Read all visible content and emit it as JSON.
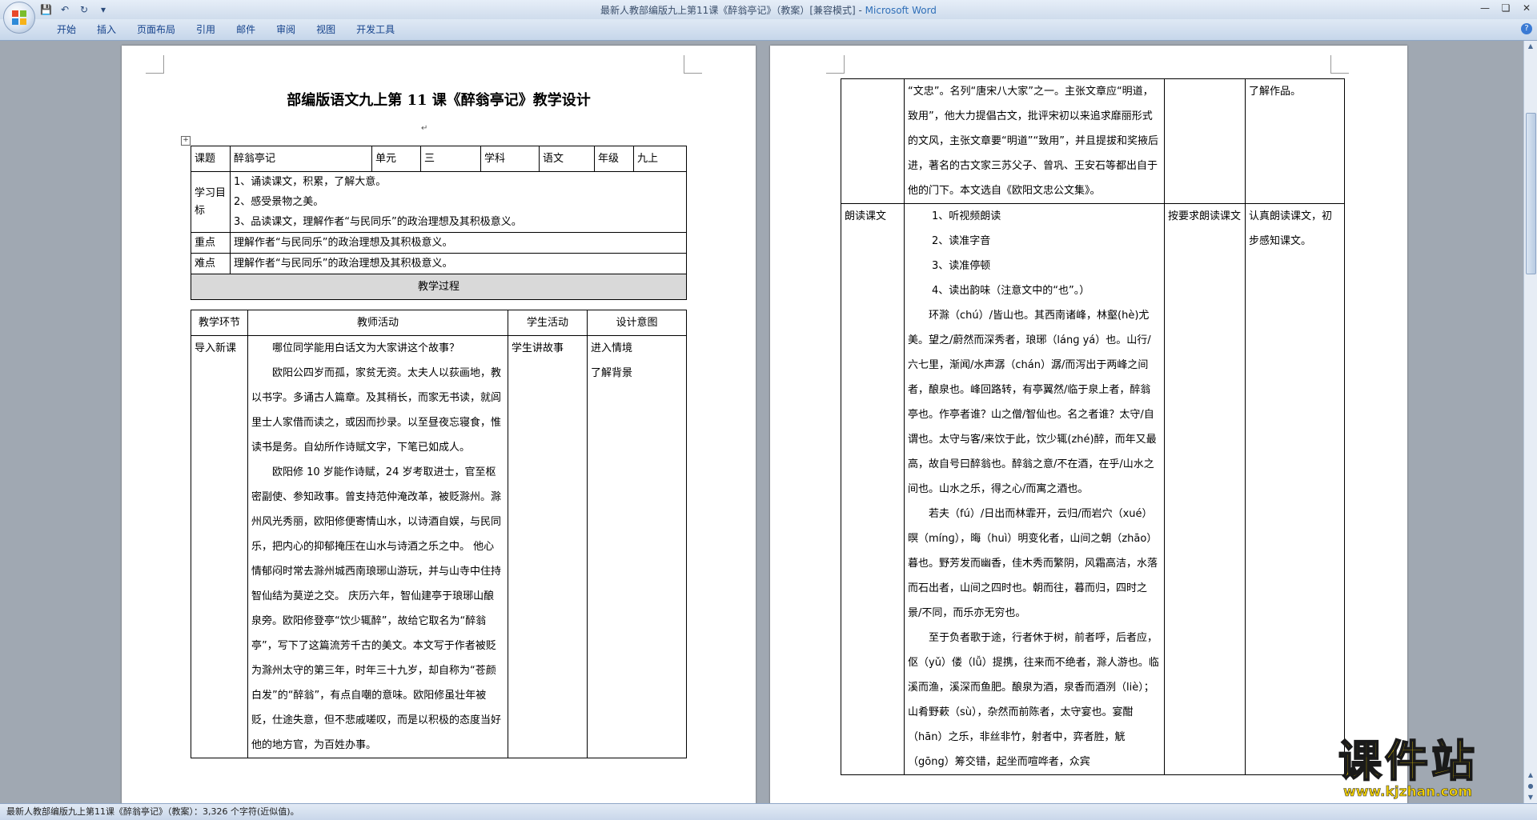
{
  "window": {
    "title": "最新人教部编版九上第11课《醉翁亭记》（教案）[兼容模式] - ",
    "app": "Microsoft Word"
  },
  "ribbon": {
    "tabs": [
      "开始",
      "插入",
      "页面布局",
      "引用",
      "邮件",
      "审阅",
      "视图",
      "开发工具"
    ]
  },
  "status": {
    "text": "最新人教部编版九上第11课《醉翁亭记》（教案）：3,326 个字符(近似值)。"
  },
  "watermark": {
    "text": "课件站",
    "url": "www.kjzhan.com"
  },
  "doc": {
    "title": "部编版语文九上第 11 课《醉翁亭记》教学设计",
    "info": {
      "keti_label": "课题",
      "keti_value": "醉翁亭记",
      "unit_label": "单元",
      "unit_value": "三",
      "subject_label": "学科",
      "subject_value": "语文",
      "grade_label": "年级",
      "grade_value": "九上"
    },
    "objectives_label": "学习目标",
    "objectives": [
      "1、诵读课文，积累，了解大意。",
      "2、感受景物之美。",
      "3、品读课文，理解作者“与民同乐”的政治理想及其积极意义。"
    ],
    "key_label": "重点",
    "key_text": "理解作者“与民同乐”的政治理想及其积极意义。",
    "diff_label": "难点",
    "diff_text": "理解作者“与民同乐”的政治理想及其积极意义。",
    "process_header": "教学过程",
    "process_cols": [
      "教学环节",
      "教师活动",
      "学生活动",
      "设计意图"
    ],
    "intro": {
      "stage": "导入新课",
      "teacher": [
        "哪位同学能用白话文为大家讲这个故事？",
        "欧阳公四岁而孤，家贫无资。太夫人以荻画地，教以书字。多诵古人篇章。及其稍长，而家无书读，就闾里士人家借而读之，或因而抄录。以至昼夜忘寝食，惟读书是务。自幼所作诗赋文字，下笔已如成人。",
        "欧阳修 10 岁能作诗赋，24 岁考取进士，官至枢密副使、参知政事。曾支持范仲淹改革，被贬滁州。滁州风光秀丽，欧阳修便寄情山水，以诗酒自娱，与民同乐，把内心的抑郁掩压在山水与诗酒之乐之中。 他心情郁闷时常去滁州城西南琅琊山游玩，并与山寺中住持智仙结为莫逆之交。 庆历六年，智仙建亭于琅琊山酿泉旁。欧阳修登亭“饮少辄醉”，故给它取名为“醉翁亭”，写下了这篇流芳千古的美文。本文写于作者被贬为滁州太守的第三年，时年三十九岁，却自称为“苍颜白发”的“醉翁”，有点自嘲的意味。欧阳修虽壮年被贬，仕途失意，但不悲戚嗟叹，而是以积极的态度当好他的地方官，为百姓办事。"
      ],
      "student": "学生讲故事",
      "intent": [
        "进入情境",
        "了解背景"
      ]
    },
    "page2": {
      "cont_teacher": "“文忠”。名列“唐宋八大家”之一。主张文章应“明道，致用”，他大力提倡古文，批评宋初以来追求靡丽形式的文风，主张文章要“明道”“致用”，并且提拔和奖掖后进，著名的古文家三苏父子、曾巩、王安石等都出自于他的门下。本文选自《欧阳文忠公文集》。",
      "cont_intent": "了解作品。",
      "read_stage": "朗读课文",
      "read_steps": [
        "1、听视频朗读",
        "2、读准字音",
        "3、读准停顿",
        "4、读出韵味（注意文中的“也”。）"
      ],
      "read_paras": [
        "环滁（chú）/皆山也。其西南诸峰，林壑(hè)尤美。望之/蔚然而深秀者，琅琊（lánɡ yá）也。山行/六七里，渐闻/水声潺（chán）潺/而泻出于两峰之间者，酿泉也。峰回路转，有亭翼然/临于泉上者，醉翁亭也。作亭者谁？山之僧/智仙也。名之者谁？太守/自谓也。太守与客/来饮于此，饮少辄(zhé)醉，而年又最高，故自号曰醉翁也。醉翁之意/不在酒，在乎/山水之间也。山水之乐，得之心/而寓之酒也。",
        "若夫（fú）/日出而林霏开，云归/而岩穴（xué）暝（mínɡ），晦（huì）明变化者，山间之朝（zhāo）暮也。野芳发而幽香，佳木秀而繁阴，风霜高洁，水落而石出者，山间之四时也。朝而往，暮而归，四时之景/不同，而乐亦无穷也。",
        "至于负者歌于途，行者休于树，前者呼，后者应，伛（yǔ）偻（lǚ）提携，往来而不绝者，滁人游也。临溪而渔，溪深而鱼肥。酿泉为酒，泉香而酒洌（liè）；山肴野蔌（sù），杂然而前陈者，太守宴也。宴酣（hān）之乐，非丝非竹，射者中，弈者胜，觥（gōng）筹交错，起坐而喧哗者，众宾"
      ],
      "read_student": "按要求朗读课文",
      "read_intent": "认真朗读课文，初步感知课文。"
    }
  }
}
